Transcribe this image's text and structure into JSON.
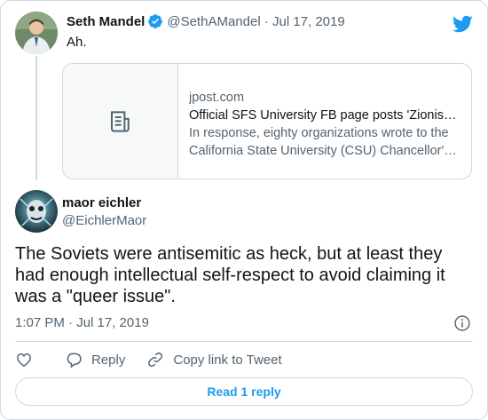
{
  "parent_tweet": {
    "author_name": "Seth Mandel",
    "meta": "@SethAMandel · Jul 17, 2019",
    "text": "Ah.",
    "link_card": {
      "domain": "jpost.com",
      "title": "Official SFS University FB page posts 'Zionism is racism'",
      "description": "In response, eighty organizations wrote to the California State University (CSU) Chancellor's office"
    }
  },
  "main_tweet": {
    "author_name": "maor eichler",
    "handle": "@EichlerMaor",
    "text": "The Soviets were antisemitic as heck, but at least they had enough intellectual self-respect to avoid claiming it was a \"queer issue\".",
    "timestamp": "1:07 PM · Jul 17, 2019"
  },
  "actions": {
    "reply_label": "Reply",
    "copy_label": "Copy link to Tweet"
  },
  "read_replies_label": "Read 1 reply",
  "colors": {
    "accent": "#1d9bf0",
    "secondary_text": "#536471",
    "border": "#cfd9de"
  },
  "icons": [
    "twitter-bird-icon",
    "verified-badge-icon",
    "article-icon",
    "info-icon",
    "heart-icon",
    "reply-bubble-icon",
    "link-icon"
  ]
}
